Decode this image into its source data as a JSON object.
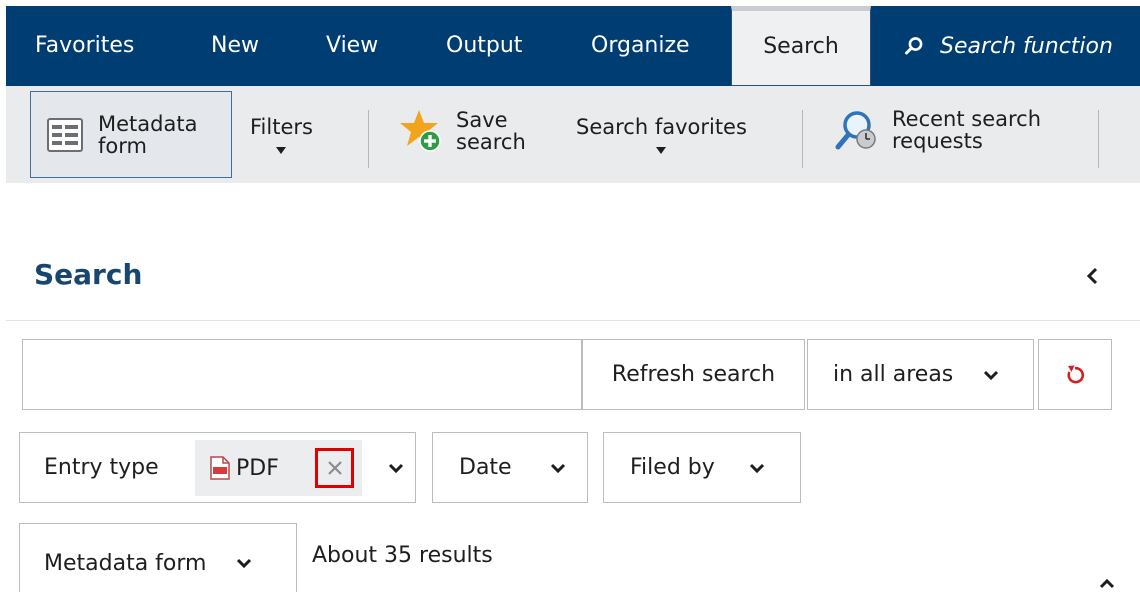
{
  "menu": {
    "tabs": [
      {
        "label": "Favorites",
        "active": false
      },
      {
        "label": "New",
        "active": false
      },
      {
        "label": "View",
        "active": false
      },
      {
        "label": "Output",
        "active": false
      },
      {
        "label": "Organize",
        "active": false
      },
      {
        "label": "Search",
        "active": true
      }
    ],
    "search_function_label": "Search function",
    "bar_color": "#003d73"
  },
  "ribbon": {
    "metadata_form": {
      "line1": "Metadata",
      "line2": "form",
      "icon": "form-icon"
    },
    "filters": {
      "label": "Filters",
      "icon": "caret-down-icon"
    },
    "save_search": {
      "line1": "Save",
      "line2": "search",
      "icon": "star-add-icon"
    },
    "search_favorites": {
      "label": "Search favorites",
      "icon": "caret-down-icon"
    },
    "recent_searches": {
      "line1": "Recent search",
      "line2": "requests",
      "icon": "search-history-icon"
    }
  },
  "panel": {
    "title": "Search",
    "query_input": {
      "value": "",
      "placeholder": ""
    },
    "refresh_label": "Refresh search",
    "scope_select": "in all areas",
    "filters": {
      "entry_type_label": "Entry type",
      "entry_type_chip": "PDF",
      "date_label": "Date",
      "filed_by_label": "Filed by"
    },
    "metadata_form_select": "Metadata form",
    "results_text": "About 35 results"
  }
}
